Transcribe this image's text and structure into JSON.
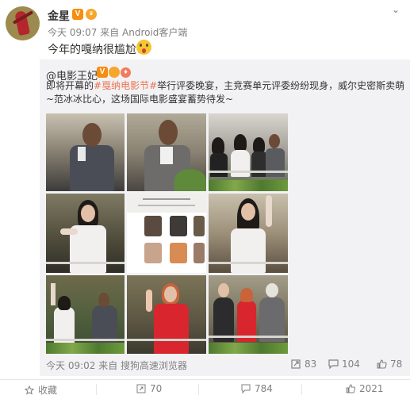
{
  "post": {
    "author": "金星",
    "verified_badge": "V",
    "time_source": "今天 09:07 来自 Android客户端",
    "text": "今年的嘎纳很尴尬！",
    "emoji": "surprised-face"
  },
  "retweet": {
    "author": "@电影王妃",
    "verified_badge": "V",
    "text_before_topic": "即将开幕的",
    "topic": "#戛纳电影节#",
    "text_after_topic": "举行评委晚宴，主竞赛单元评委纷纷现身，威尔史密斯卖萌~范冰冰比心，这场国际电影盛宴蓄势待发~",
    "time_source": "今天 09:02 来自 搜狗高速浏览器",
    "shares": "83",
    "comments": "104",
    "likes": "78"
  },
  "actions": {
    "favorite": "收藏",
    "repost": "70",
    "comment": "784",
    "like": "2021"
  },
  "colors": {
    "link_orange": "#eb7350",
    "meta_gray": "#808080",
    "card_bg": "#f2f2f5",
    "vip_orange": "#f78d0f"
  }
}
